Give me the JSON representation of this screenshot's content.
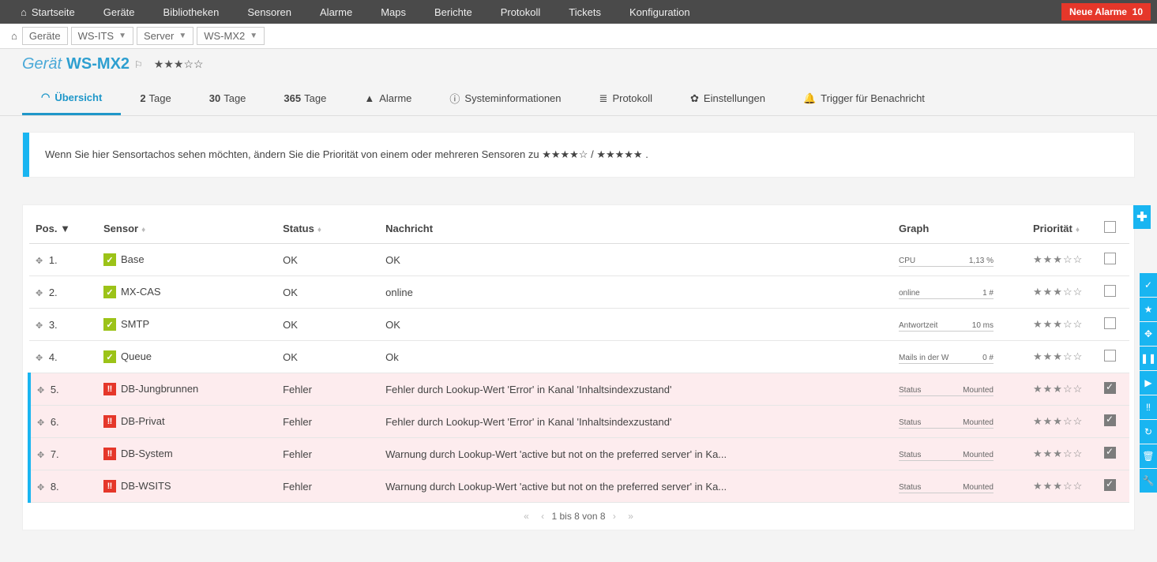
{
  "topnav": {
    "home": "Startseite",
    "items": [
      "Geräte",
      "Bibliotheken",
      "Sensoren",
      "Alarme",
      "Maps",
      "Berichte",
      "Protokoll",
      "Tickets",
      "Konfiguration"
    ],
    "alarm_label": "Neue Alarme",
    "alarm_count": "10"
  },
  "breadcrumb": {
    "items": [
      "Geräte",
      "WS-ITS",
      "Server",
      "WS-MX2"
    ]
  },
  "title": {
    "label": "Gerät",
    "device": "WS-MX2"
  },
  "tabs": {
    "overview": "Übersicht",
    "d2n": "2",
    "d2l": "Tage",
    "d30n": "30",
    "d30l": "Tage",
    "d365n": "365",
    "d365l": "Tage",
    "alarms": "Alarme",
    "sysinfo": "Systeminformationen",
    "protocol": "Protokoll",
    "settings": "Einstellungen",
    "trigger": "Trigger für Benachricht"
  },
  "info": {
    "text": "Wenn Sie hier Sensortachos sehen möchten, ändern Sie die Priorität von einem oder mehreren Sensoren zu ",
    "dot": "."
  },
  "columns": {
    "pos": "Pos.",
    "sensor": "Sensor",
    "status": "Status",
    "msg": "Nachricht",
    "graph": "Graph",
    "prio": "Priorität"
  },
  "rows": [
    {
      "pos": "1.",
      "name": "Base",
      "ok": true,
      "status": "OK",
      "msg": "OK",
      "gl": "CPU",
      "gv": "1,13 %",
      "chk": false
    },
    {
      "pos": "2.",
      "name": "MX-CAS",
      "ok": true,
      "status": "OK",
      "msg": "online",
      "gl": "online",
      "gv": "1 #",
      "chk": false
    },
    {
      "pos": "3.",
      "name": "SMTP",
      "ok": true,
      "status": "OK",
      "msg": "OK",
      "gl": "Antwortzeit",
      "gv": "10 ms",
      "chk": false
    },
    {
      "pos": "4.",
      "name": "Queue",
      "ok": true,
      "status": "OK",
      "msg": "Ok",
      "gl": "Mails in der W",
      "gv": "0 #",
      "chk": false
    },
    {
      "pos": "5.",
      "name": "DB-Jungbrunnen",
      "ok": false,
      "status": "Fehler",
      "msg": "Fehler durch Lookup-Wert 'Error' in Kanal 'Inhaltsindexzustand'",
      "gl": "Status",
      "gv": "Mounted",
      "chk": true
    },
    {
      "pos": "6.",
      "name": "DB-Privat",
      "ok": false,
      "status": "Fehler",
      "msg": "Fehler durch Lookup-Wert 'Error' in Kanal 'Inhaltsindexzustand'",
      "gl": "Status",
      "gv": "Mounted",
      "chk": true
    },
    {
      "pos": "7.",
      "name": "DB-System",
      "ok": false,
      "status": "Fehler",
      "msg": "Warnung durch Lookup-Wert 'active but not on the preferred server' in Ka...",
      "gl": "Status",
      "gv": "Mounted",
      "chk": true
    },
    {
      "pos": "8.",
      "name": "DB-WSITS",
      "ok": false,
      "status": "Fehler",
      "msg": "Warnung durch Lookup-Wert 'active but not on the preferred server' in Ka...",
      "gl": "Status",
      "gv": "Mounted",
      "chk": true
    }
  ],
  "pager": {
    "label": "1 bis 8 von 8"
  }
}
